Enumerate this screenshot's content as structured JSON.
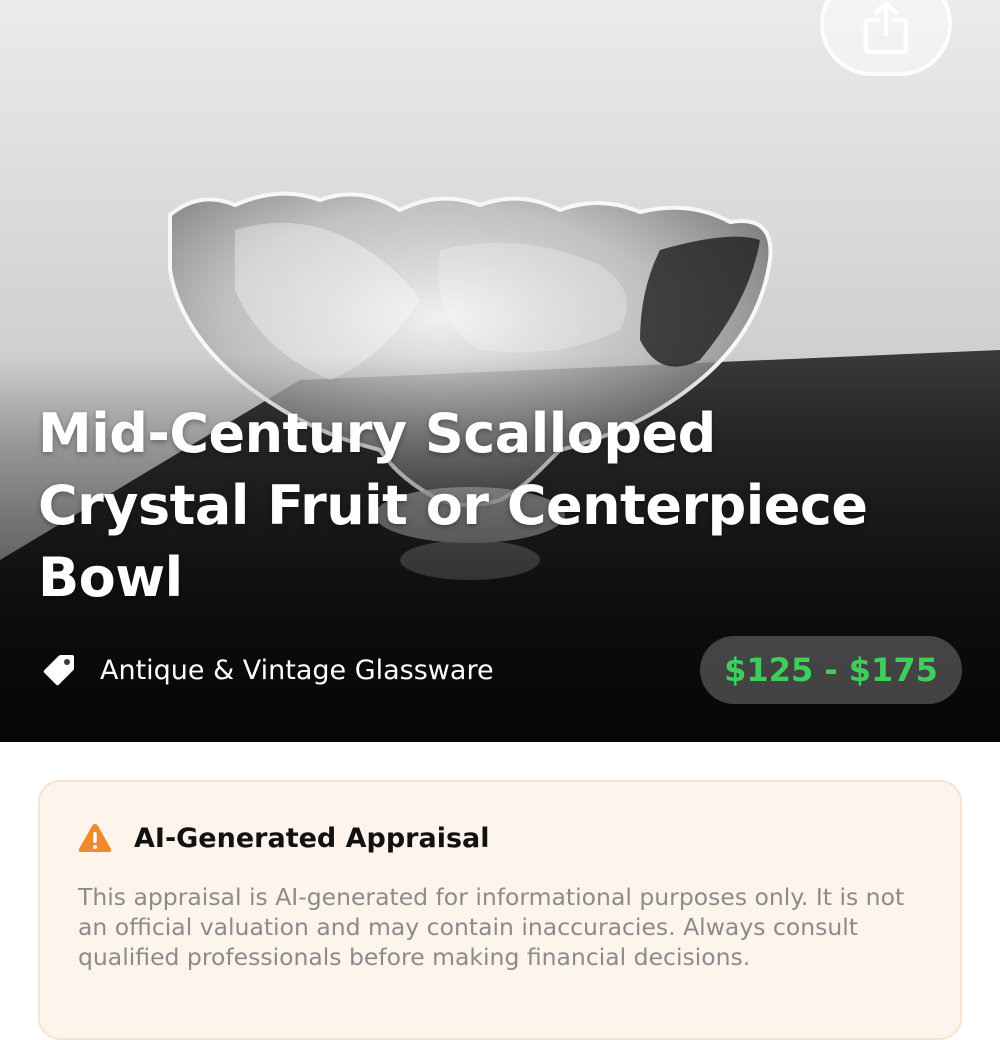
{
  "hero": {
    "photo_alt": "Scalloped crystal bowl",
    "title": "Mid-Century Scalloped Crystal Fruit or Centerpiece Bowl",
    "category": "Antique & Vintage Glassware",
    "price_range": "$125 - $175",
    "share_icon": "share-icon",
    "category_icon": "tag-icon"
  },
  "disclaimer": {
    "icon": "warning-icon",
    "title": "AI-Generated Appraisal",
    "body": "This appraisal is AI-generated for informational purposes only. It is not an official valuation and may contain inaccuracies. Always consult qualified professionals before making financial decisions."
  },
  "colors": {
    "price_green": "#3fce5c",
    "warning_orange": "#f08a2e",
    "card_background": "#fdf4ec",
    "body_text_gray": "#8b8b8e"
  }
}
